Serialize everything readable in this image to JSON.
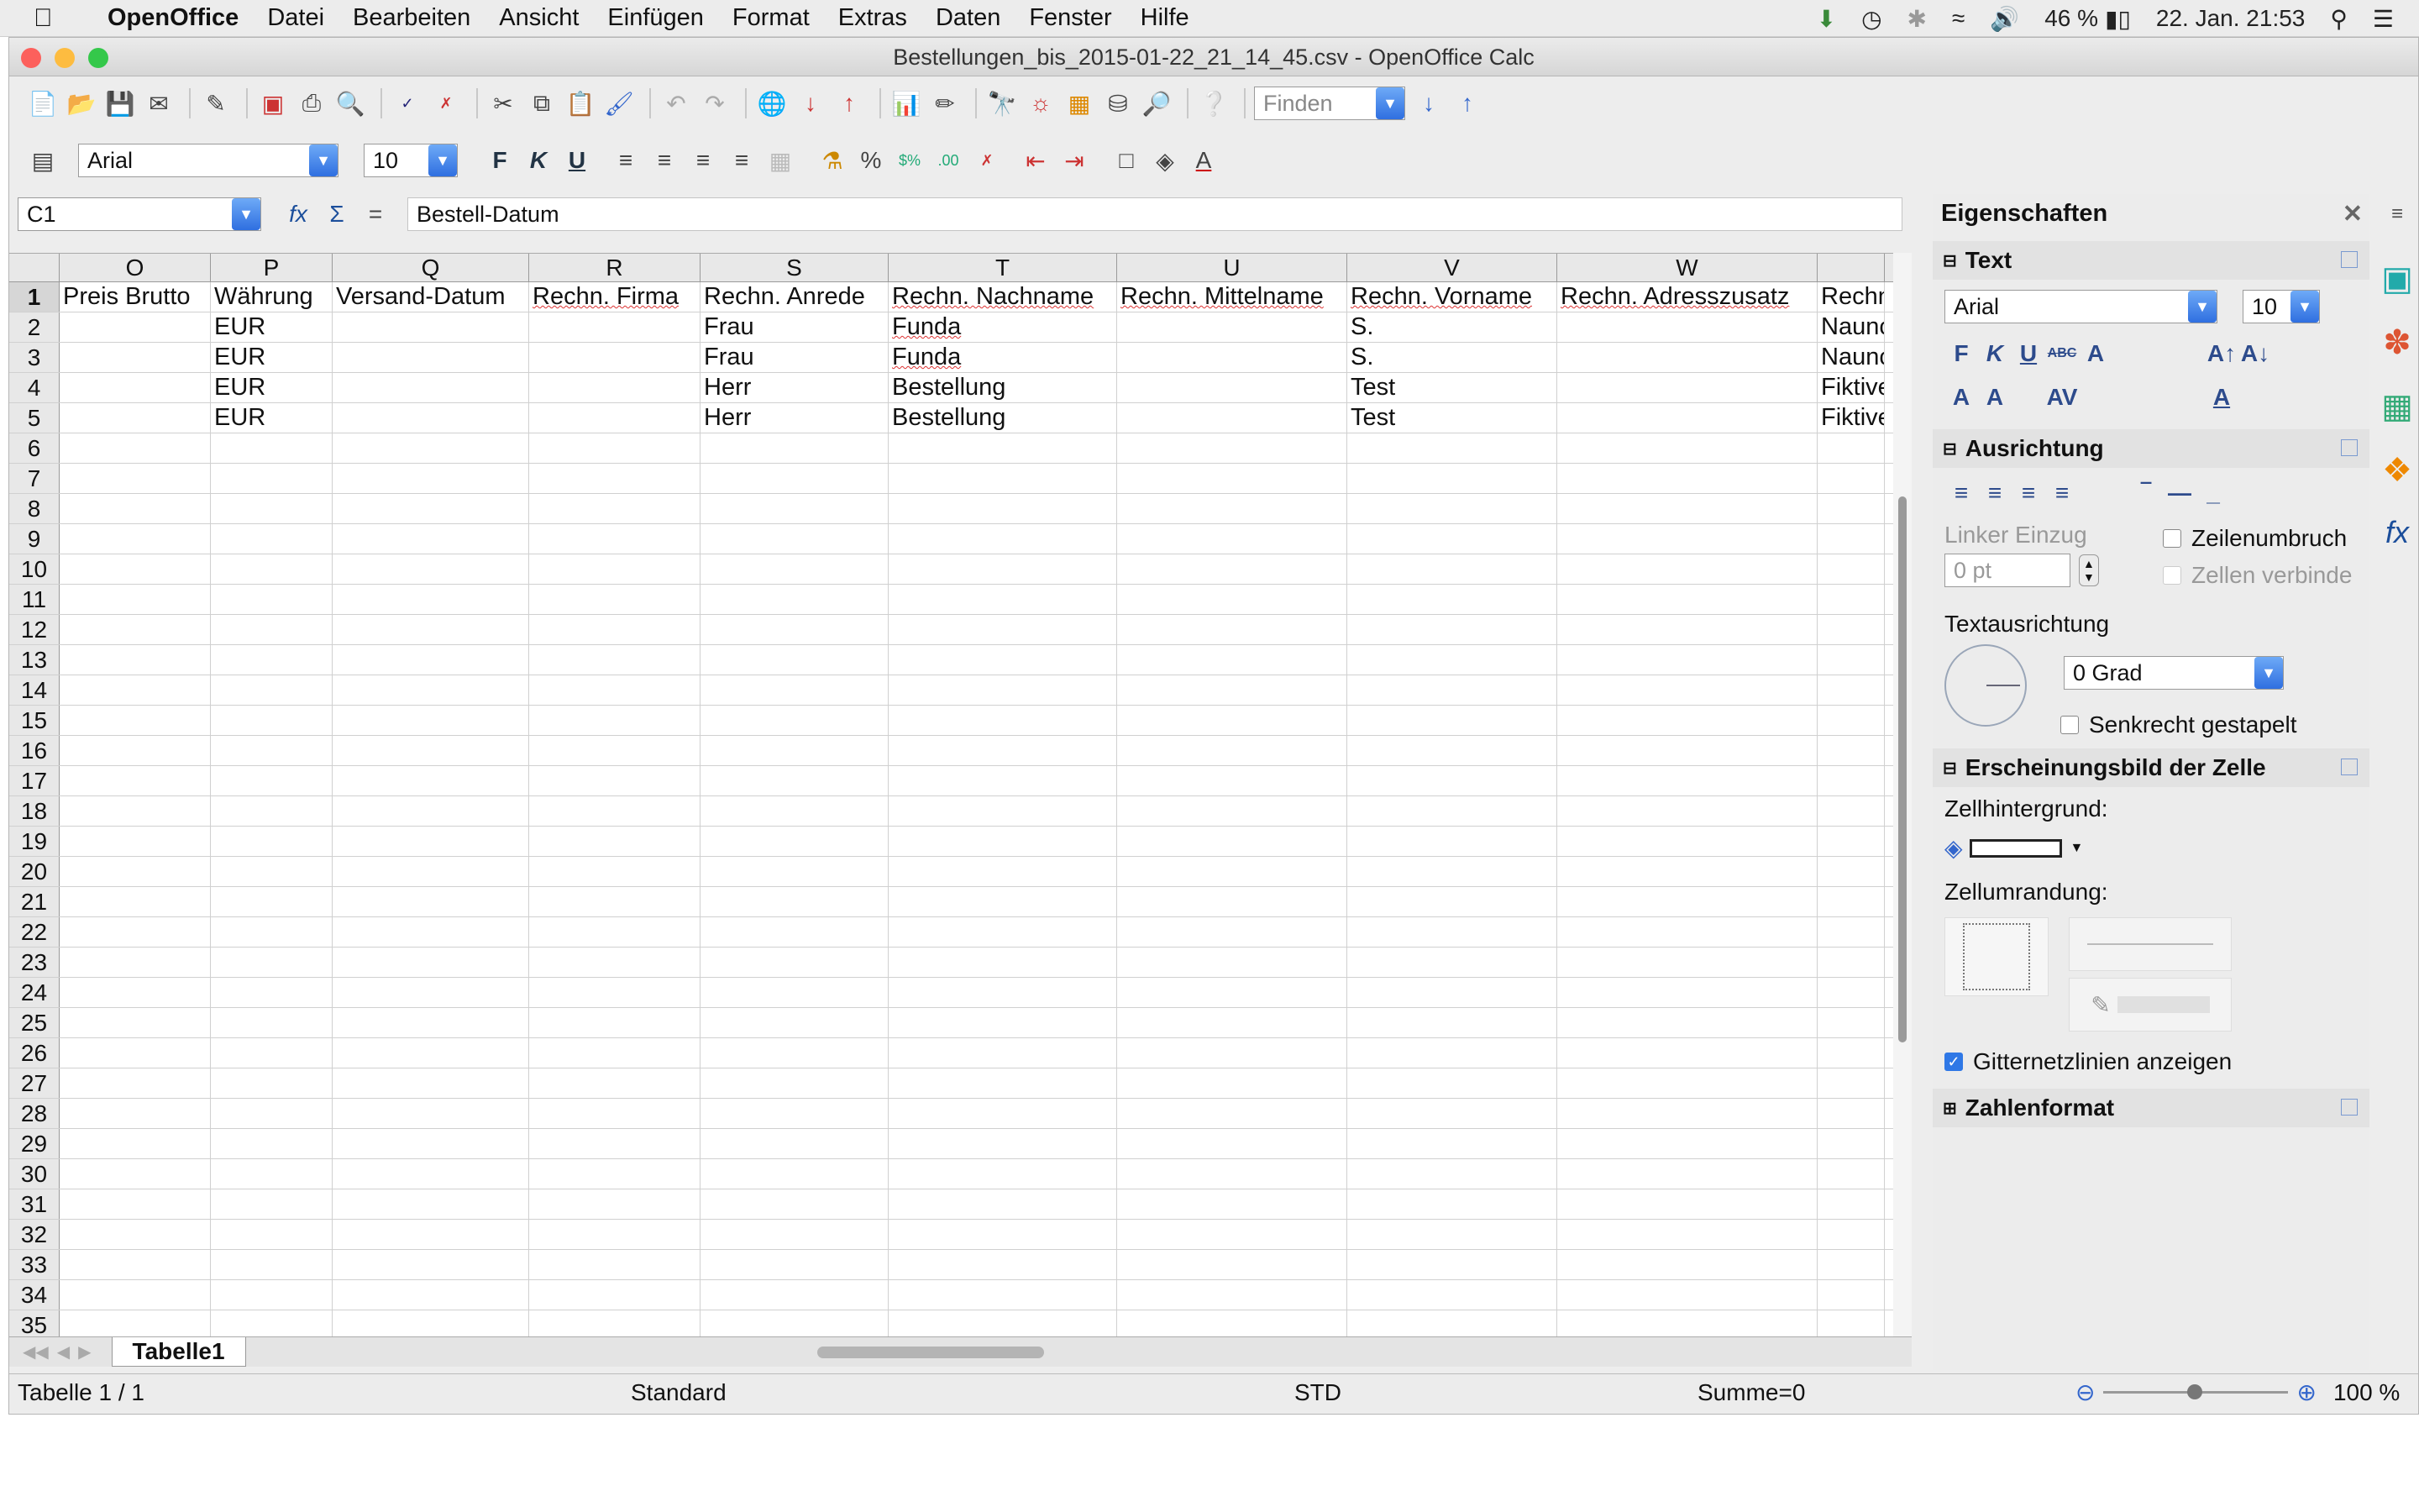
{
  "menubar": {
    "app_name": "OpenOffice",
    "menus": [
      "Datei",
      "Bearbeiten",
      "Ansicht",
      "Einfügen",
      "Format",
      "Extras",
      "Daten",
      "Fenster",
      "Hilfe"
    ],
    "battery": "46 %",
    "datetime": "22. Jan.  21:53"
  },
  "window": {
    "title": "Bestellungen_bis_2015-01-22_21_14_45.csv - OpenOffice Calc"
  },
  "toolbar": {
    "find_placeholder": "Finden",
    "font_name": "Arial",
    "font_size": "10"
  },
  "formula_bar": {
    "cell_ref": "C1",
    "content": "Bestell-Datum"
  },
  "sheet": {
    "columns": [
      "O",
      "P",
      "Q",
      "R",
      "S",
      "T",
      "U",
      "V",
      "W",
      ""
    ],
    "header_row": [
      "Preis Brutto",
      "Währung",
      "Versand-Datum",
      "Rechn. Firma",
      "Rechn. Anrede",
      "Rechn. Nachname",
      "Rechn. Mittelname",
      "Rechn. Vorname",
      "Rechn. Adresszusatz",
      "Rechn"
    ],
    "data_rows": [
      [
        "",
        "EUR",
        "",
        "",
        "Frau",
        "Funda",
        "",
        "S.",
        "",
        "Naunc"
      ],
      [
        "",
        "EUR",
        "",
        "",
        "Frau",
        "Funda",
        "",
        "S.",
        "",
        "Naunc"
      ],
      [
        "",
        "EUR",
        "",
        "",
        "Herr",
        "Bestellung",
        "",
        "Test",
        "",
        "Fiktive"
      ],
      [
        "",
        "EUR",
        "",
        "",
        "Herr",
        "Bestellung",
        "",
        "Test",
        "",
        "Fiktive"
      ]
    ],
    "row_numbers": [
      "1",
      "2",
      "3",
      "4",
      "5",
      "6",
      "7",
      "8",
      "9",
      "10",
      "11",
      "12",
      "13",
      "14",
      "15",
      "16",
      "17",
      "18",
      "19",
      "20",
      "21",
      "22",
      "23",
      "24",
      "25",
      "26",
      "27",
      "28",
      "29",
      "30",
      "31",
      "32",
      "33",
      "34",
      "35"
    ],
    "tab_name": "Tabelle1"
  },
  "statusbar": {
    "sheet_info": "Tabelle 1 / 1",
    "page_style": "Standard",
    "mode": "STD",
    "sum": "Summe=0",
    "zoom": "100 %"
  },
  "sidebar": {
    "title": "Eigenschaften",
    "text_section": "Text",
    "font_name": "Arial",
    "font_size": "10",
    "align_section": "Ausrichtung",
    "left_indent_label": "Linker Einzug",
    "left_indent_value": "0 pt",
    "wrap_label": "Zeilenumbruch",
    "merge_label": "Zellen verbinde",
    "orientation_label": "Textausrichtung",
    "rotation_value": "0 Grad",
    "stacked_label": "Senkrecht gestapelt",
    "appearance_section": "Erscheinungsbild der Zelle",
    "bg_label": "Zellhintergrund:",
    "border_label": "Zellumrandung:",
    "gridlines_label": "Gitternetzlinien anzeigen",
    "gridlines_checked": true,
    "number_section": "Zahlenformat"
  }
}
